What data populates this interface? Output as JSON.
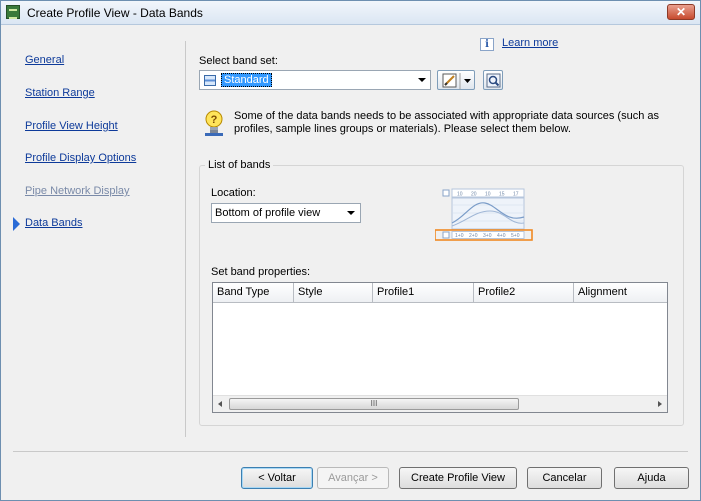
{
  "window": {
    "title": "Create Profile View - Data Bands",
    "close_label": "✕"
  },
  "nav": {
    "items": [
      {
        "label": "General",
        "state": "link"
      },
      {
        "label": "Station Range",
        "state": "link"
      },
      {
        "label": "Profile View Height",
        "state": "link"
      },
      {
        "label": "Profile Display Options",
        "state": "link"
      },
      {
        "label": "Pipe Network Display",
        "state": "disabled"
      },
      {
        "label": "Data Bands",
        "state": "active"
      }
    ]
  },
  "help": {
    "learn_more": "Learn more",
    "info_icon": "i"
  },
  "band_set": {
    "label": "Select band set:",
    "value": "Standard"
  },
  "notice": {
    "text": "Some of the data bands needs to be associated with appropriate data sources (such as profiles, sample lines groups or materials). Please select them below."
  },
  "list_of_bands": {
    "title": "List of bands",
    "location_label": "Location:",
    "location_value": "Bottom of profile view",
    "preview_ticks": [
      "10",
      "20",
      "10",
      "15",
      "17"
    ],
    "preview_band": [
      "1+0",
      "2+0",
      "3+0",
      "4+0",
      "5+0"
    ]
  },
  "band_properties": {
    "label": "Set band properties:",
    "columns": [
      "Band Type",
      "Style",
      "Profile1",
      "Profile2",
      "Alignment"
    ],
    "rows": [],
    "scroll_thumb": "III"
  },
  "buttons": {
    "back": "< Voltar",
    "next": "Avançar >",
    "create": "Create Profile View",
    "cancel": "Cancelar",
    "help": "Ajuda"
  },
  "colors": {
    "link": "#0d3a9a",
    "accent": "#2a6bd6",
    "highlight_band": "#f08a24",
    "selection": "#3399ff"
  }
}
